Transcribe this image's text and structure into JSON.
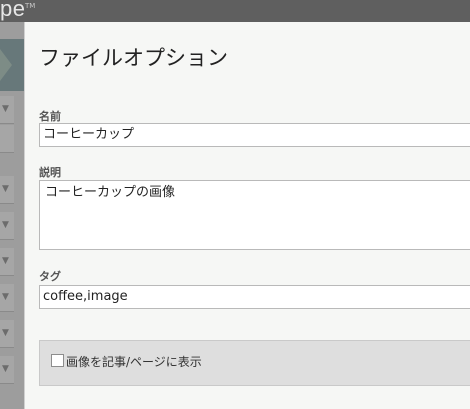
{
  "app": {
    "brand_text": "pe",
    "brand_mark": "TM"
  },
  "dialog": {
    "title": "ファイルオプション",
    "name": {
      "label": "名前",
      "value": "コーヒーカップ"
    },
    "description": {
      "label": "説明",
      "value": "コーヒーカップの画像"
    },
    "tags": {
      "label": "タグ",
      "value": "coffee,image"
    },
    "options": {
      "show_image_label": "画像を記事/ページに表示",
      "show_image_checked": false
    }
  },
  "icons": {
    "sidebar_arrow": "chevron-down-icon"
  }
}
